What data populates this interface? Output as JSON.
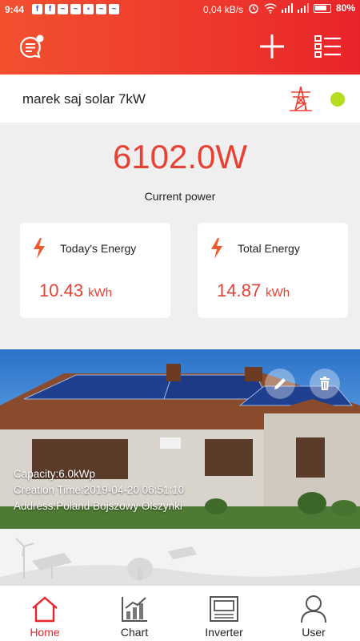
{
  "status_bar": {
    "time": "9:44",
    "network_speed": "0,04 kB/s",
    "battery": "80%",
    "notification_icons": [
      "facebook-icon",
      "facebook-icon",
      "messenger-icon",
      "messenger-icon",
      "app-icon",
      "messenger-icon",
      "messenger-icon"
    ]
  },
  "header": {
    "icons": [
      "message-icon",
      "plus-icon",
      "list-icon"
    ]
  },
  "plant": {
    "name": "marek saj solar 7kW",
    "status_color": "#b6dc1e"
  },
  "power": {
    "value": "6102.0W",
    "label": "Current power"
  },
  "cards": {
    "today": {
      "title": "Today's Energy",
      "value": "10.43",
      "unit": "kWh"
    },
    "total": {
      "title": "Total Energy",
      "value": "14.87",
      "unit": "kWh"
    }
  },
  "photo": {
    "capacity": "Capacity:6.0kWp",
    "creation_time": "Creation Time:2019-04-20 06:51:10",
    "address": "Address:Poland Bojszowy Olszynki"
  },
  "tabs": [
    {
      "label": "Home",
      "icon": "home-icon",
      "active": true
    },
    {
      "label": "Chart",
      "icon": "chart-icon",
      "active": false
    },
    {
      "label": "Inverter",
      "icon": "inverter-icon",
      "active": false
    },
    {
      "label": "User",
      "icon": "user-icon",
      "active": false
    }
  ],
  "colors": {
    "accent": "#e8242a",
    "value_red": "#e84033"
  }
}
